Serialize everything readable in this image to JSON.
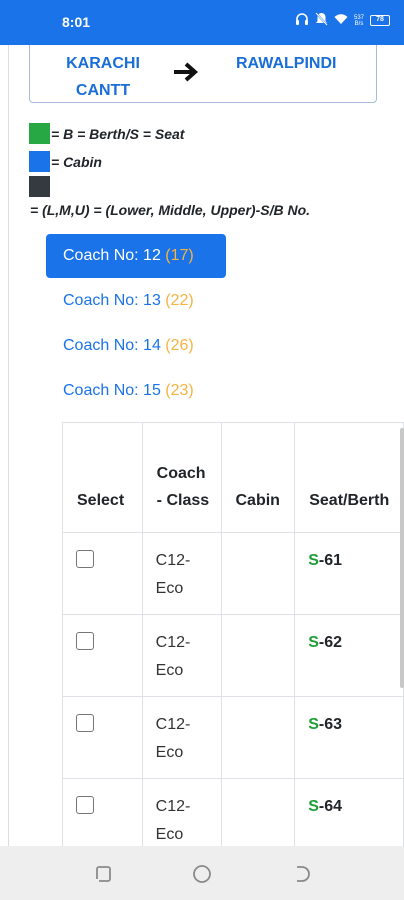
{
  "status": {
    "time": "8:01",
    "speed_value": "537",
    "speed_unit": "B/s",
    "battery": "78"
  },
  "route": {
    "from": "KARACHI CANTT",
    "to": "RAWALPINDI",
    "arrow_icon": "arrow-right-icon"
  },
  "legend": [
    {
      "color": "#28a745",
      "text": "= B = Berth/S = Seat"
    },
    {
      "color": "#1a73e8",
      "text": "= Cabin"
    },
    {
      "color": "#343a40",
      "text": ""
    },
    {
      "color": "",
      "text": "= (L,M,U) = (Lower, Middle, Upper)-S/B No."
    }
  ],
  "coaches": [
    {
      "label": "Coach No: 12",
      "count": "(17)",
      "active": true
    },
    {
      "label": "Coach No: 13",
      "count": "(22)",
      "active": false
    },
    {
      "label": "Coach No: 14",
      "count": "(26)",
      "active": false
    },
    {
      "label": "Coach No: 15",
      "count": "(23)",
      "active": false
    }
  ],
  "table": {
    "headers": [
      "Select",
      "Coach - Class",
      "Cabin",
      "Seat/Berth"
    ],
    "rows": [
      {
        "coach_class": "C12-Eco",
        "cabin": "",
        "seat_prefix": "S",
        "seat_no": "-61"
      },
      {
        "coach_class": "C12-Eco",
        "cabin": "",
        "seat_prefix": "S",
        "seat_no": "-62"
      },
      {
        "coach_class": "C12-Eco",
        "cabin": "",
        "seat_prefix": "S",
        "seat_no": "-63"
      },
      {
        "coach_class": "C12-Eco",
        "cabin": "",
        "seat_prefix": "S",
        "seat_no": "-64"
      }
    ]
  },
  "colors": {
    "accent": "#1a73e8",
    "count": "#f5b341",
    "seat_letter": "#1e9e36"
  }
}
